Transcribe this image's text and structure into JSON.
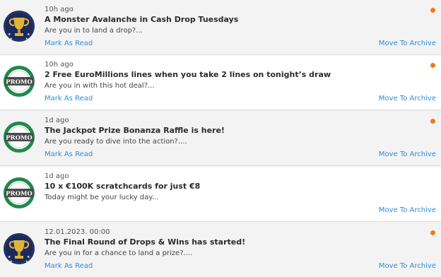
{
  "notifications": [
    {
      "icon": "trophy-icon",
      "time": "10h ago",
      "title": "A Monster Avalanche in Cash Drop Tuesdays",
      "desc": "Are you in to land a drop?...",
      "mark": "Mark As Read",
      "archive": "Move To Archive",
      "unread": true
    },
    {
      "icon": "promo-icon",
      "icon_text": "PROMO",
      "time": "10h ago",
      "title": "2 Free EuroMillions lines when you take 2 lines on tonight’s draw",
      "desc": "Are you in with this hot deal?...",
      "mark": "Mark As Read",
      "archive": "Move To Archive",
      "unread": true
    },
    {
      "icon": "promo-icon",
      "icon_text": "PROMO",
      "time": "1d ago",
      "title": "The Jackpot Prize Bonanza Raffle is here!",
      "desc": "Are you ready to dive into the action?....",
      "mark": "Mark As Read",
      "archive": "Move To Archive",
      "unread": true
    },
    {
      "icon": "promo-icon",
      "icon_text": "PROMO",
      "time": "1d ago",
      "title": "10 x €100K scratchcards for just €8",
      "desc": "Today might be your lucky day...",
      "mark": "",
      "archive": "Move To Archive",
      "unread": false
    },
    {
      "icon": "trophy-icon",
      "time": "12.01.2023. 00:00",
      "title": "The Final Round of Drops & Wins has started!",
      "desc": "Are you in for a chance to land a prize?....",
      "mark": "Mark As Read",
      "archive": "Move To Archive",
      "unread": true
    }
  ],
  "colors": {
    "link": "#2f8ed8",
    "unread_dot": "#f07a1b",
    "promo_green": "#1e8a4c",
    "trophy_navy": "#1b2a5a",
    "trophy_gold": "#e0b43a"
  }
}
